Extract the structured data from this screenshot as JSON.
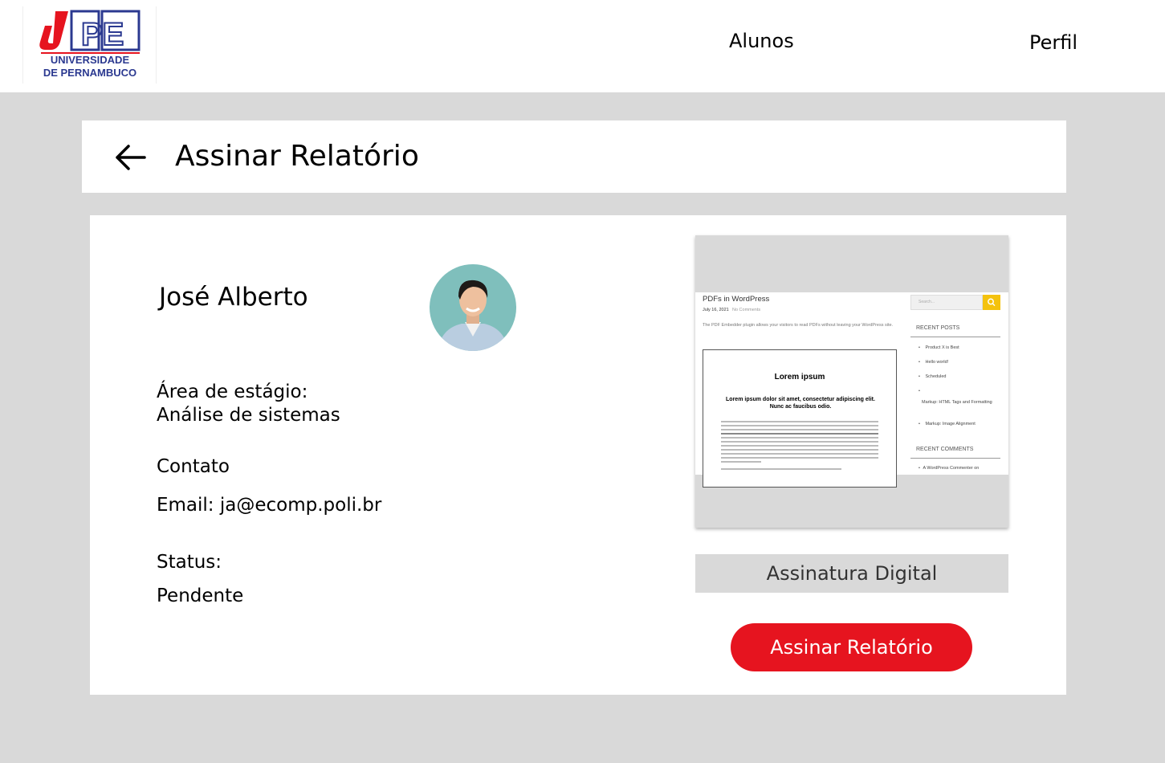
{
  "header": {
    "logo": {
      "mark": "UPE",
      "line1": "UNIVERSIDADE",
      "line2": "DE PERNAMBUCO"
    },
    "nav": {
      "students": "Alunos",
      "profile": "Perfil"
    }
  },
  "page": {
    "title": "Assinar Relatório"
  },
  "student": {
    "name": "José Alberto",
    "area_label": "Área de estágio:",
    "area_value": "Análise de sistemas",
    "contact_label": "Contato",
    "email": "Email: ja@ecomp.poli.br",
    "status_label": "Status:",
    "status_value": "Pendente"
  },
  "preview": {
    "post_title": "PDFs in WordPress",
    "post_date": "July 16, 2021",
    "post_comments": "No Comments",
    "intro": "The PDF Embedder plugin allows your visitors to read PDFs without leaving your WordPress site.",
    "pdf_title": "Lorem ipsum",
    "pdf_subtitle": "Lorem ipsum dolor sit amet, consectetur adipiscing elit. Nunc ac faucibus odio.",
    "search_placeholder": "Search...",
    "recent_posts_heading": "RECENT POSTS",
    "recent_posts": [
      "Product X is Best",
      "Hello world!",
      "Scheduled",
      "Markup: HTML Tags and Formatting",
      "Markup: Image Alignment"
    ],
    "recent_comments_heading": "RECENT COMMENTS",
    "recent_comment": "A WordPress Commenter on"
  },
  "actions": {
    "digital_signature": "Assinatura Digital",
    "sign_report": "Assinar Relatório"
  },
  "colors": {
    "brand_red": "#e6141f",
    "brand_blue": "#2b3990",
    "wp_search_yellow": "#f4c20d"
  }
}
